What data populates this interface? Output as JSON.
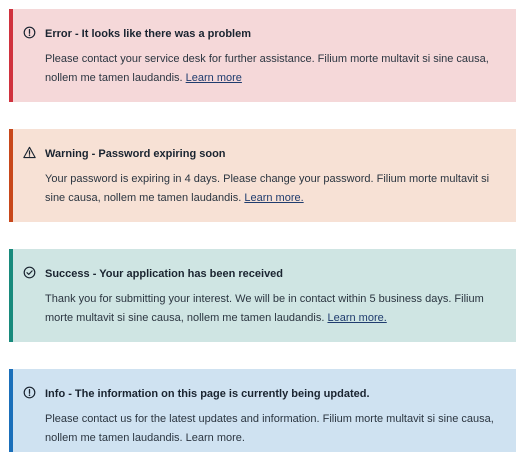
{
  "alerts": [
    {
      "type": "error",
      "icon": "info-circle-icon",
      "title": "Error - It looks like there was a problem",
      "body": "Please contact your service desk for further assistance. Filium morte multavit si sine causa, nollem me tamen laudandis.",
      "link": "Learn more",
      "accent": "#d0323e",
      "background": "#f5d8d9"
    },
    {
      "type": "warning",
      "icon": "warning-triangle-icon",
      "title": "Warning - Password expiring soon",
      "body": "Your password is expiring in 4 days. Please change your password. Filium morte multavit si sine causa, nollem me tamen laudandis.",
      "link": "Learn more.",
      "accent": "#c8471a",
      "background": "#f7e1d5"
    },
    {
      "type": "success",
      "icon": "check-circle-icon",
      "title": "Success - Your application has been received",
      "body": "Thank you for submitting your interest. We will be in contact within 5 business days. Filium morte multavit si sine causa, nollem me tamen laudandis.",
      "link": "Learn more.",
      "accent": "#188a7c",
      "background": "#cfe5e3"
    },
    {
      "type": "info",
      "icon": "info-circle-icon",
      "title": "Info - The information on this page is currently being updated.",
      "body": "Please contact us for the latest updates and information. Filium morte multavit si sine causa, nollem me tamen laudandis.",
      "link": "Learn more.",
      "accent": "#1a6fba",
      "background": "#cfe2f1"
    }
  ]
}
